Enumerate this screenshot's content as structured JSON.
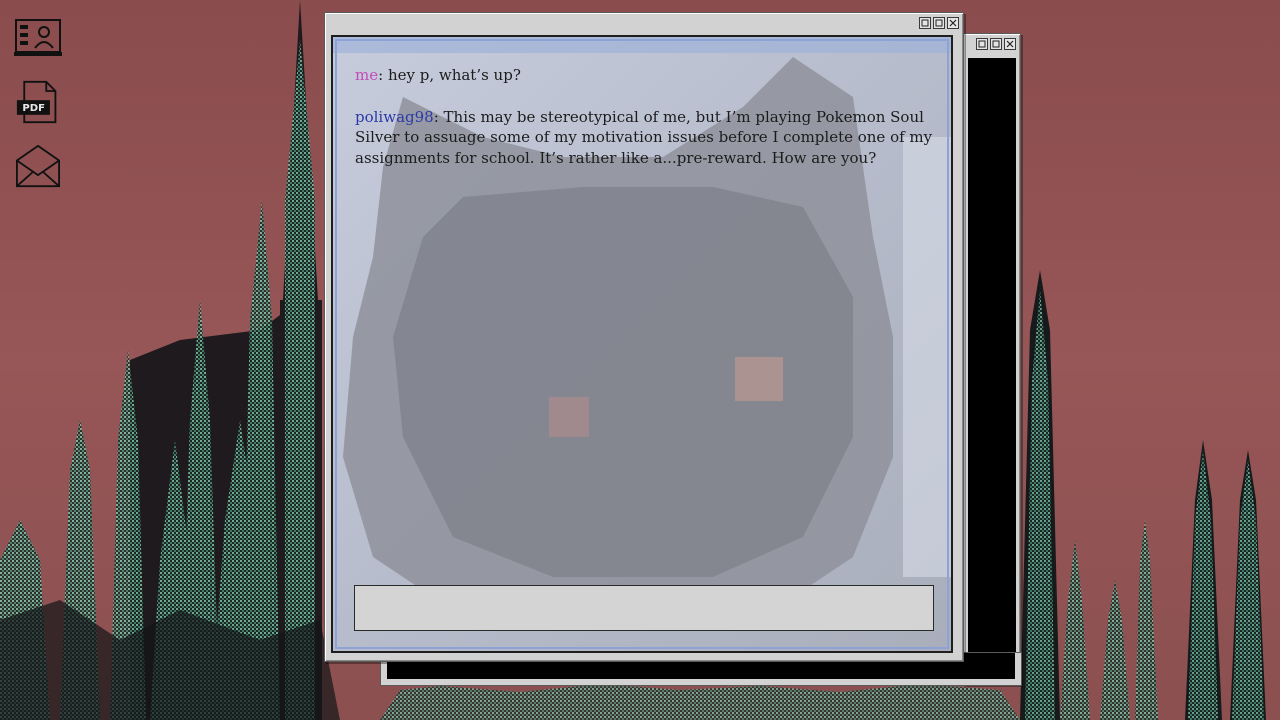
{
  "desktop": {
    "icons": [
      {
        "name": "contact-card-icon",
        "label": ""
      },
      {
        "name": "pdf-file-icon",
        "label": "PDF"
      },
      {
        "name": "mail-envelope-icon",
        "label": ""
      }
    ]
  },
  "chat_window": {
    "messages": [
      {
        "sender": "me",
        "separator": ": ",
        "text": "hey p, what’s up?"
      },
      {
        "sender": "poliwag98",
        "separator": ": ",
        "text": "This may be stereotypical of me, but I’m playing Pokemon Soul Silver to assuage some of my motivation issues before I complete one of my assignments for school. It’s rather like a...pre-reward. How are you?"
      }
    ],
    "input": {
      "value": "",
      "placeholder": ""
    }
  },
  "colors": {
    "sender_me": "#c34ab8",
    "sender_other": "#2b3aa8",
    "sky": "#8d4f4f",
    "spires": "#5fa890"
  },
  "title_buttons": [
    "minimize-icon",
    "maximize-icon",
    "close-icon"
  ]
}
